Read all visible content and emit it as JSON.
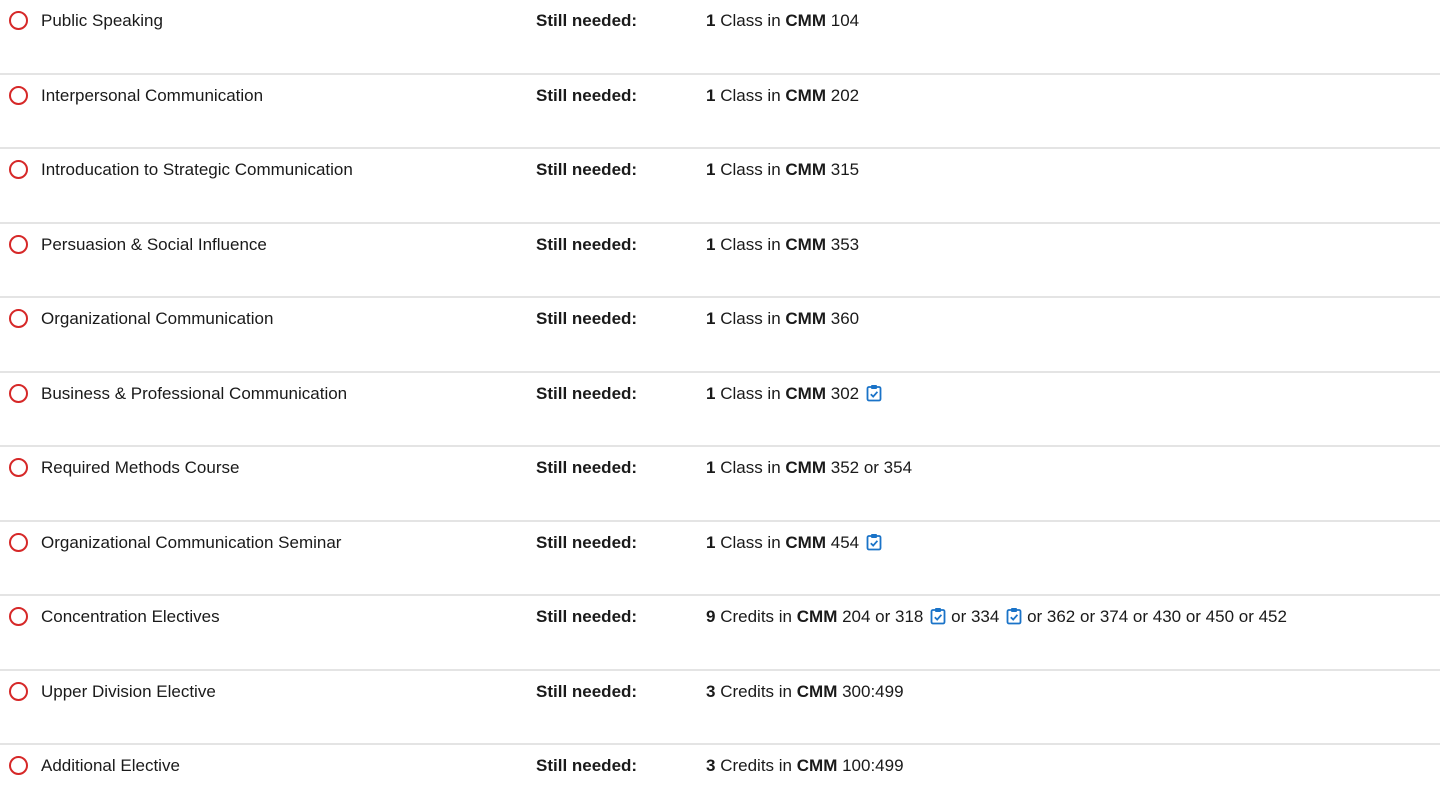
{
  "still_needed_label": "Still needed:",
  "requirements": [
    {
      "title": "Public Speaking",
      "qty": "1",
      "unit": "Class in",
      "subject": "CMM",
      "courses": [
        {
          "text": "104",
          "icon": false
        }
      ]
    },
    {
      "title": "Interpersonal Communication",
      "qty": "1",
      "unit": "Class in",
      "subject": "CMM",
      "courses": [
        {
          "text": "202",
          "icon": false
        }
      ]
    },
    {
      "title": "Introducation to Strategic Communication",
      "qty": "1",
      "unit": "Class in",
      "subject": "CMM",
      "courses": [
        {
          "text": "315",
          "icon": false
        }
      ]
    },
    {
      "title": "Persuasion & Social Influence",
      "qty": "1",
      "unit": "Class in",
      "subject": "CMM",
      "courses": [
        {
          "text": "353",
          "icon": false
        }
      ]
    },
    {
      "title": "Organizational Communication",
      "qty": "1",
      "unit": "Class in",
      "subject": "CMM",
      "courses": [
        {
          "text": "360",
          "icon": false
        }
      ]
    },
    {
      "title": "Business & Professional Communication",
      "qty": "1",
      "unit": "Class in",
      "subject": "CMM",
      "courses": [
        {
          "text": "302",
          "icon": true
        }
      ]
    },
    {
      "title": "Required Methods Course",
      "qty": "1",
      "unit": "Class in",
      "subject": "CMM",
      "courses": [
        {
          "text": "352 or 354",
          "icon": false
        }
      ]
    },
    {
      "title": "Organizational Communication Seminar",
      "qty": "1",
      "unit": "Class in",
      "subject": "CMM",
      "courses": [
        {
          "text": "454",
          "icon": true
        }
      ]
    },
    {
      "title": "Concentration Electives",
      "qty": "9",
      "unit": "Credits in",
      "subject": "CMM",
      "courses": [
        {
          "text": "204 or 318",
          "icon": true
        },
        {
          "text": "or 334",
          "icon": true
        },
        {
          "text": "or 362 or 374 or 430 or 450 or 452",
          "icon": false
        }
      ]
    },
    {
      "title": "Upper Division Elective",
      "qty": "3",
      "unit": "Credits in",
      "subject": "CMM",
      "courses": [
        {
          "text": "300:499",
          "icon": false
        }
      ]
    },
    {
      "title": "Additional Elective",
      "qty": "3",
      "unit": "Credits in",
      "subject": "CMM",
      "courses": [
        {
          "text": "100:499",
          "icon": false
        }
      ]
    }
  ],
  "colors": {
    "status_incomplete": "#d62828",
    "icon_blue": "#1a73c8",
    "divider": "#e4e4e4"
  },
  "icons": {
    "status": "incomplete-circle-icon",
    "course_info": "clipboard-check-icon"
  }
}
